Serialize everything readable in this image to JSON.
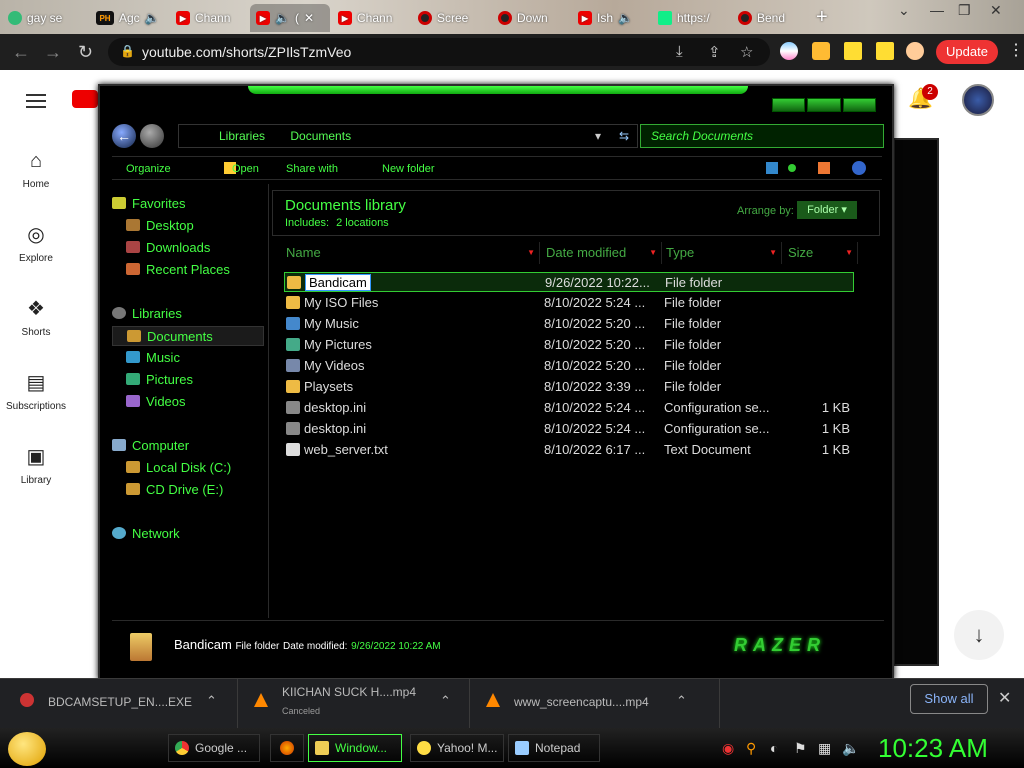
{
  "browser": {
    "tabs": [
      {
        "label": "gay se"
      },
      {
        "label": "Agc"
      },
      {
        "label": "Chann"
      },
      {
        "label": "("
      },
      {
        "label": "Chann"
      },
      {
        "label": "Scree"
      },
      {
        "label": "Down"
      },
      {
        "label": "Ish"
      },
      {
        "label": "https:/"
      },
      {
        "label": "Bend"
      }
    ],
    "url": "youtube.com/shorts/ZPIlsTzmVeo",
    "update_label": "Update",
    "notification_count": "2"
  },
  "youtube": {
    "nav": [
      {
        "label": "Home",
        "icon": "home-icon"
      },
      {
        "label": "Explore",
        "icon": "compass-icon"
      },
      {
        "label": "Shorts",
        "icon": "shorts-icon"
      },
      {
        "label": "Subscriptions",
        "icon": "subscriptions-icon"
      },
      {
        "label": "Library",
        "icon": "library-icon"
      }
    ]
  },
  "explorer": {
    "breadcrumbs": [
      "Libraries",
      "Documents"
    ],
    "search_placeholder": "Search Documents",
    "toolbar": {
      "organize": "Organize",
      "open": "Open",
      "share_with": "Share with",
      "new_folder": "New folder"
    },
    "nav": {
      "favorites": "Favorites",
      "desktop": "Desktop",
      "downloads": "Downloads",
      "recent_places": "Recent Places",
      "libraries": "Libraries",
      "documents": "Documents",
      "music": "Music",
      "pictures": "Pictures",
      "videos": "Videos",
      "computer": "Computer",
      "local_disk": "Local Disk (C:)",
      "cd_drive": "CD Drive (E:)",
      "network": "Network"
    },
    "library": {
      "title": "Documents library",
      "includes_label": "Includes:",
      "includes_value": "2 locations",
      "arrange_label": "Arrange by:",
      "arrange_value": "Folder"
    },
    "columns": {
      "name": "Name",
      "date": "Date modified",
      "type": "Type",
      "size": "Size"
    },
    "files": [
      {
        "name": "Bandicam",
        "date": "9/26/2022 10:22...",
        "type": "File folder",
        "size": ""
      },
      {
        "name": "My ISO Files",
        "date": "8/10/2022 5:24 ...",
        "type": "File folder",
        "size": ""
      },
      {
        "name": "My Music",
        "date": "8/10/2022 5:20 ...",
        "type": "File folder",
        "size": ""
      },
      {
        "name": "My Pictures",
        "date": "8/10/2022 5:20 ...",
        "type": "File folder",
        "size": ""
      },
      {
        "name": "My Videos",
        "date": "8/10/2022 5:20 ...",
        "type": "File folder",
        "size": ""
      },
      {
        "name": "Playsets",
        "date": "8/10/2022 3:39 ...",
        "type": "File folder",
        "size": ""
      },
      {
        "name": "desktop.ini",
        "date": "8/10/2022 5:24 ...",
        "type": "Configuration se...",
        "size": "1 KB"
      },
      {
        "name": "desktop.ini",
        "date": "8/10/2022 5:24 ...",
        "type": "Configuration se...",
        "size": "1 KB"
      },
      {
        "name": "web_server.txt",
        "date": "8/10/2022 6:17 ...",
        "type": "Text Document",
        "size": "1 KB"
      }
    ],
    "details": {
      "name": "Bandicam",
      "kind": "File folder",
      "date_label": "Date modified:",
      "date_value": "9/26/2022 10:22 AM"
    }
  },
  "downloads": [
    {
      "name": "BDCAMSETUP_EN....EXE",
      "status": ""
    },
    {
      "name": "KIICHAN SUCK H....mp4",
      "status": "Canceled"
    },
    {
      "name": "www_screencaptu....mp4",
      "status": ""
    }
  ],
  "show_all": "Show all",
  "taskbar": {
    "items": [
      {
        "label": "Google ..."
      },
      {
        "label": "Window..."
      },
      {
        "label": "Yahoo! M..."
      },
      {
        "label": "Notepad"
      }
    ],
    "clock": "10:23 AM"
  },
  "colors": {
    "accent_green": "#44ff44",
    "youtube_red": "#ee0000",
    "update_red": "#ee3333"
  }
}
